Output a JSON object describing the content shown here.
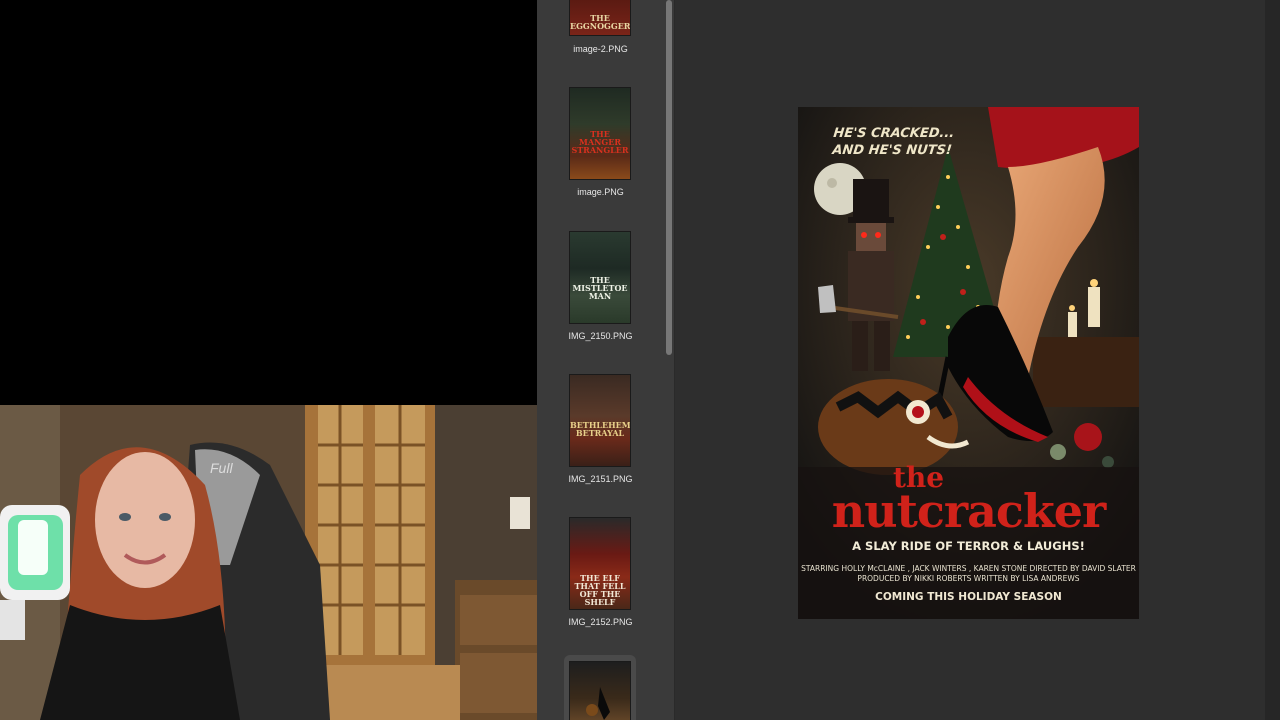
{
  "file_browser": {
    "thumbnails": [
      {
        "filename": "image-2.PNG",
        "poster_title": "THE EGGNOGGER"
      },
      {
        "filename": "image.PNG",
        "poster_title": "THE MANGER STRANGLER"
      },
      {
        "filename": "IMG_2150.PNG",
        "poster_title": "THE MISTLETOE MAN"
      },
      {
        "filename": "IMG_2151.PNG",
        "poster_title": "BETHLEHEM BETRAYAL"
      },
      {
        "filename": "IMG_2152.PNG",
        "poster_title": "THE ELF THAT FELL OFF THE SHELF"
      }
    ]
  },
  "preview": {
    "poster": {
      "tagline_1": "HE'S CRACKED...",
      "tagline_2": "AND HE'S NUTS!",
      "title_1": "the",
      "title_2": "nutcracker",
      "subtitle": "A SLAY RIDE OF TERROR & LAUGHS!",
      "credits_1": "STARRING HOLLY McCLAINE , JACK WINTERS , KAREN STONE  DIRECTED BY DAVID SLATER",
      "credits_2": "PRODUCED BY NIKKI ROBERTS  WRITTEN BY LISA ANDREWS",
      "coming": "COMING THIS HOLIDAY SEASON"
    }
  },
  "webcam": {
    "chair_brand": "Full"
  },
  "colors": {
    "sidebar_bg": "#3a3a3a",
    "preview_bg": "#2e2e2e",
    "poster_title_red": "#d0221a"
  }
}
